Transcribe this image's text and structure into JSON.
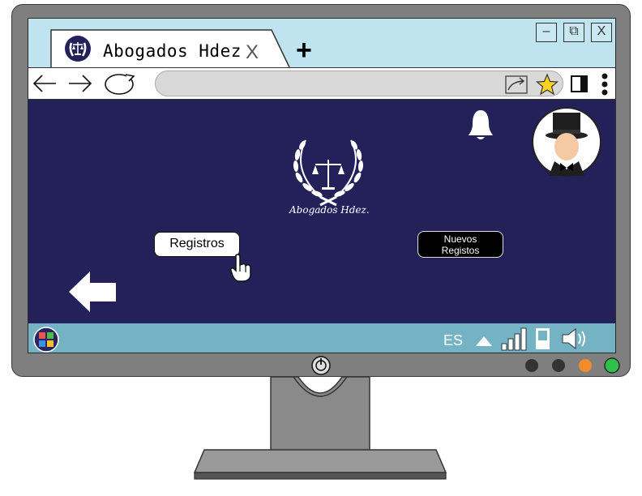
{
  "browser": {
    "tab_title": "Abogados  Hdez",
    "tab_close": "X",
    "new_tab": "+",
    "window_controls": {
      "minimize": "–",
      "restore": "⧉",
      "close": "X"
    }
  },
  "page": {
    "logo_text": "Abogados Hdez.",
    "registros_button": "Registros",
    "nuevos_line1": "Nuevos",
    "nuevos_line2": "Registos"
  },
  "taskbar": {
    "language": "ES"
  },
  "colors": {
    "page_background": "#23205a",
    "titlebar": "#bfe3ef",
    "taskbar": "#73b3c4",
    "monitor_frame": "#7f7f7f"
  },
  "icons": [
    "legal-scales-logo-icon",
    "back-arrow-icon",
    "forward-arrow-icon",
    "refresh-icon",
    "share-icon",
    "star-icon",
    "sidebar-icon",
    "more-menu-icon",
    "bell-icon",
    "user-avatar-icon",
    "big-back-arrow-icon",
    "hand-pointer-icon",
    "start-menu-icon",
    "up-arrow-icon",
    "signal-icon",
    "battery-icon",
    "speaker-icon",
    "power-icon"
  ]
}
